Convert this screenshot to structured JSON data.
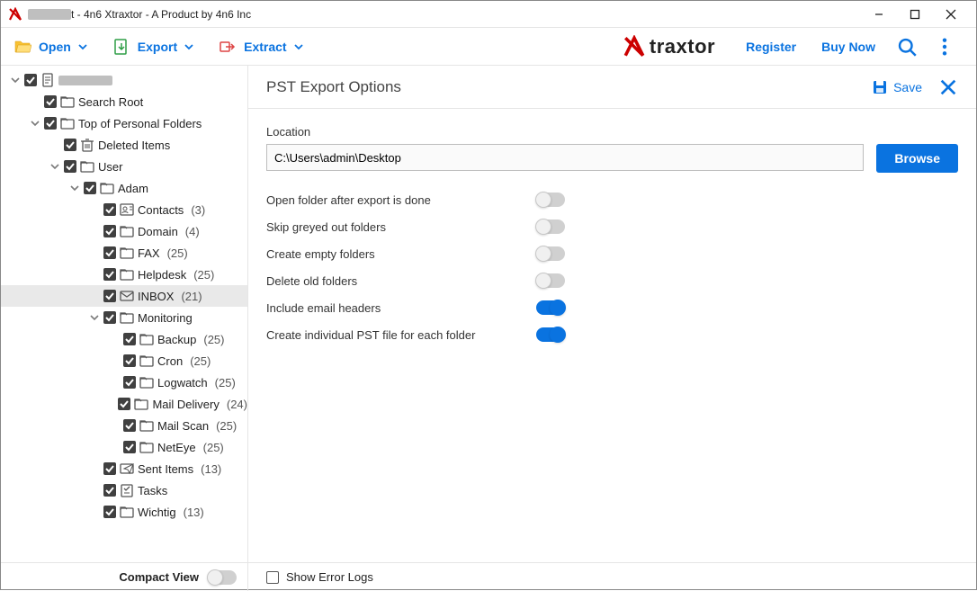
{
  "window": {
    "title_suffix": "t - 4n6 Xtraxtor - A Product by 4n6 Inc"
  },
  "toolbar": {
    "open": "Open",
    "export": "Export",
    "extract": "Extract",
    "register": "Register",
    "buy_now": "Buy Now",
    "brand_text": "traxtor"
  },
  "sidebar": {
    "compact_view": "Compact View",
    "tree": [
      {
        "depth": 0,
        "exp": "down",
        "icon": "file",
        "label": "",
        "redacted": true
      },
      {
        "depth": 1,
        "exp": "none",
        "icon": "folder",
        "label": "Search Root"
      },
      {
        "depth": 1,
        "exp": "down",
        "icon": "folder",
        "label": "Top of Personal Folders"
      },
      {
        "depth": 2,
        "exp": "none",
        "icon": "trash",
        "label": "Deleted Items"
      },
      {
        "depth": 2,
        "exp": "down",
        "icon": "folder",
        "label": "User"
      },
      {
        "depth": 3,
        "exp": "down",
        "icon": "folder",
        "label": "Adam"
      },
      {
        "depth": 4,
        "exp": "none",
        "icon": "contacts",
        "label": "Contacts",
        "count": "(3)"
      },
      {
        "depth": 4,
        "exp": "none",
        "icon": "folder",
        "label": "Domain",
        "count": "(4)"
      },
      {
        "depth": 4,
        "exp": "none",
        "icon": "folder",
        "label": "FAX",
        "count": "(25)"
      },
      {
        "depth": 4,
        "exp": "none",
        "icon": "folder",
        "label": "Helpdesk",
        "count": "(25)"
      },
      {
        "depth": 4,
        "exp": "none",
        "icon": "mail",
        "label": "INBOX",
        "count": "(21)",
        "selected": true
      },
      {
        "depth": 4,
        "exp": "down",
        "icon": "folder",
        "label": "Monitoring"
      },
      {
        "depth": 5,
        "exp": "none",
        "icon": "folder",
        "label": "Backup",
        "count": "(25)"
      },
      {
        "depth": 5,
        "exp": "none",
        "icon": "folder",
        "label": "Cron",
        "count": "(25)"
      },
      {
        "depth": 5,
        "exp": "none",
        "icon": "folder",
        "label": "Logwatch",
        "count": "(25)"
      },
      {
        "depth": 5,
        "exp": "none",
        "icon": "folder",
        "label": "Mail Delivery",
        "count": "(24)"
      },
      {
        "depth": 5,
        "exp": "none",
        "icon": "folder",
        "label": "Mail Scan",
        "count": "(25)"
      },
      {
        "depth": 5,
        "exp": "none",
        "icon": "folder",
        "label": "NetEye",
        "count": "(25)"
      },
      {
        "depth": 4,
        "exp": "none",
        "icon": "sent",
        "label": "Sent Items",
        "count": "(13)"
      },
      {
        "depth": 4,
        "exp": "none",
        "icon": "tasks",
        "label": "Tasks"
      },
      {
        "depth": 4,
        "exp": "none",
        "icon": "folder",
        "label": "Wichtig",
        "count": "(13)"
      }
    ]
  },
  "panel": {
    "title": "PST Export Options",
    "save": "Save",
    "location_label": "Location",
    "location_value": "C:\\Users\\admin\\Desktop",
    "browse": "Browse",
    "options": [
      {
        "label": "Open folder after export is done",
        "on": false
      },
      {
        "label": "Skip greyed out folders",
        "on": false
      },
      {
        "label": "Create empty folders",
        "on": false
      },
      {
        "label": "Delete old folders",
        "on": false
      },
      {
        "label": "Include email headers",
        "on": true
      },
      {
        "label": "Create individual PST file for each folder",
        "on": true
      }
    ],
    "show_error_logs": "Show Error Logs"
  },
  "colors": {
    "accent": "#0a73e0"
  }
}
